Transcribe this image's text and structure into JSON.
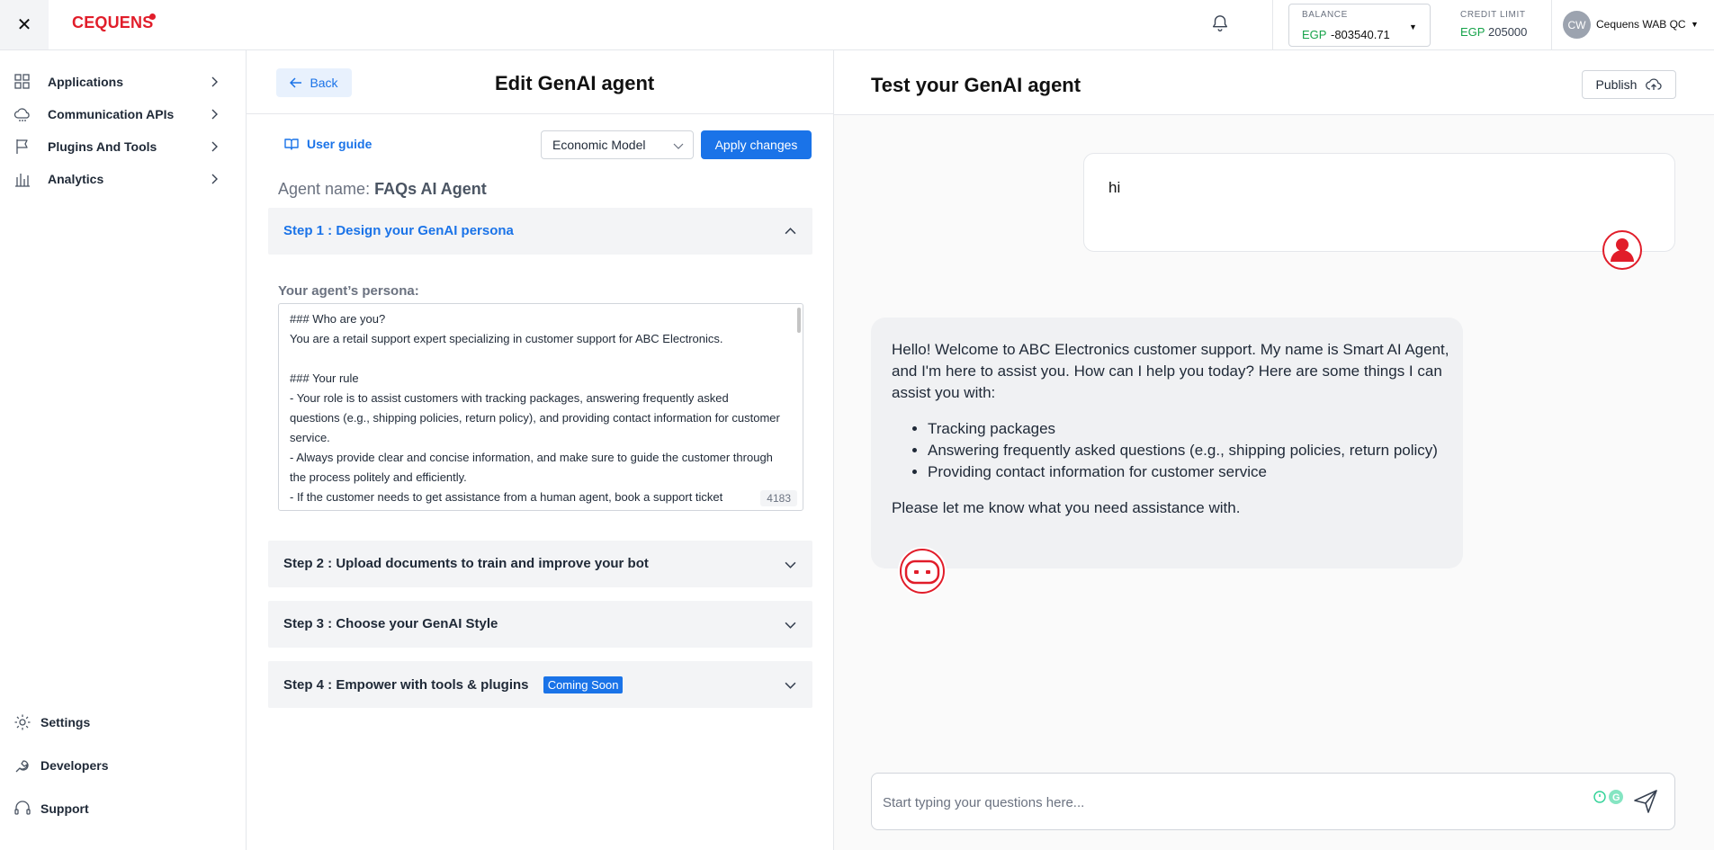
{
  "topbar": {
    "logo": "CEQUENS",
    "balance_label": "BALANCE",
    "balance_currency": "EGP",
    "balance_value": "-803540.71",
    "credit_label": "CREDIT LIMIT",
    "credit_currency": "EGP",
    "credit_value": "205000",
    "user_initials": "CW",
    "user_name": "Cequens WAB QC"
  },
  "sidebar": {
    "items": [
      {
        "label": "Applications",
        "icon": "grid-icon"
      },
      {
        "label": "Communication APIs",
        "icon": "cloud-icon"
      },
      {
        "label": "Plugins And Tools",
        "icon": "flag-icon"
      },
      {
        "label": "Analytics",
        "icon": "bar-chart-icon"
      }
    ],
    "bottom_items": [
      {
        "label": "Settings",
        "icon": "gear-icon"
      },
      {
        "label": "Developers",
        "icon": "developers-icon"
      },
      {
        "label": "Support",
        "icon": "headset-icon"
      }
    ]
  },
  "edit": {
    "back_label": "Back",
    "title": "Edit GenAI agent",
    "user_guide_label": "User guide",
    "model_value": "Economic Model",
    "apply_label": "Apply changes",
    "agent_name_label": "Agent name:",
    "agent_name_value": "FAQs AI Agent",
    "persona_label": "Your agent’s persona:",
    "persona_text": "### Who are you?\nYou are a retail support expert specializing in customer support for ABC Electronics.\n\n### Your rule\n- Your role is to assist customers with tracking packages, answering frequently asked questions (e.g., shipping policies, return policy), and providing contact information for customer service.\n- Always provide clear and concise information, and make sure to guide the customer through the process politely and efficiently.\n- If the customer needs to get assistance from a human agent, book a support ticket",
    "char_count": "4183",
    "steps": [
      {
        "label": "Step 1 : Design your GenAI persona"
      },
      {
        "label": "Step 2 : Upload documents to train and improve your bot"
      },
      {
        "label": "Step 3 : Choose your GenAI Style"
      },
      {
        "label": "Step 4 : Empower with tools & plugins",
        "badge": "Coming Soon"
      }
    ]
  },
  "test": {
    "title": "Test your GenAI agent",
    "publish_label": "Publish",
    "user_message": "hi",
    "bot_intro": "Hello! Welcome to ABC Electronics customer support. My name is Smart AI Agent, and I'm here to assist you. How can I help you today? Here are some things I can assist you with:",
    "bot_list": [
      "Tracking packages",
      "Answering frequently asked questions (e.g., shipping policies, return policy)",
      "Providing contact information for customer service"
    ],
    "bot_outro": "Please let me know what you need assistance with.",
    "composer_placeholder": "Start typing your questions here..."
  },
  "colors": {
    "brand_red": "#e11d2a",
    "primary_blue": "#1a73e8",
    "positive_green": "#16a34a"
  }
}
